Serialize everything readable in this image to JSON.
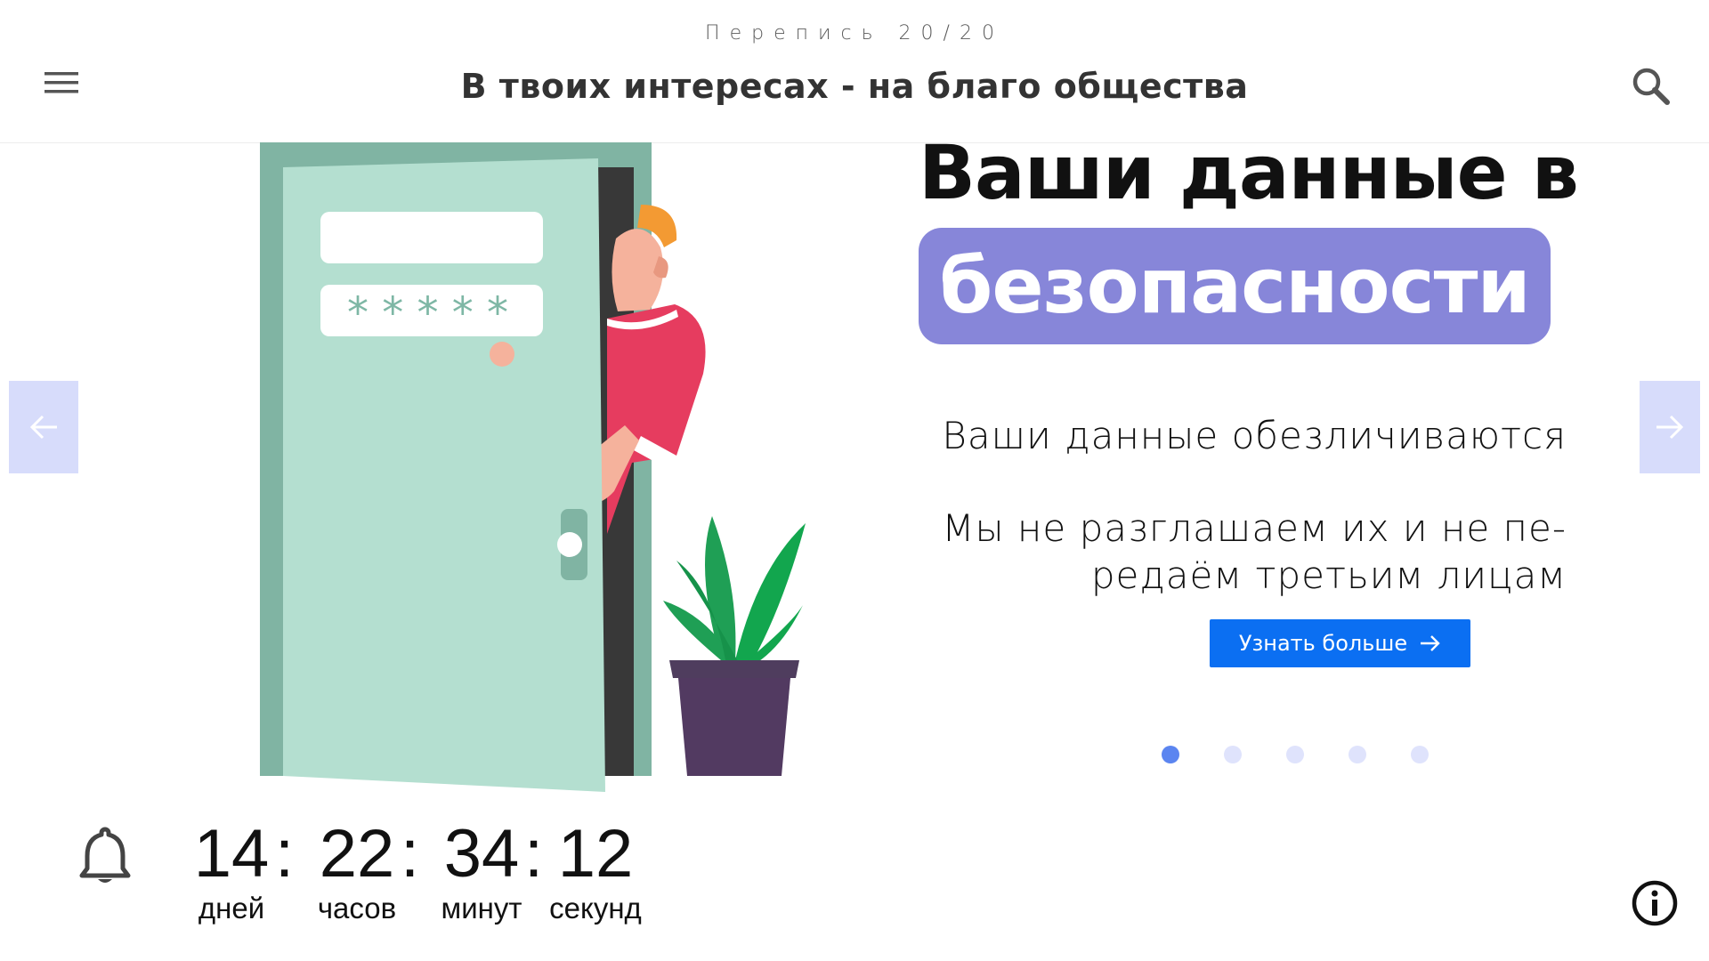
{
  "header": {
    "brand": "Перепись 20/20",
    "tagline": "В твоих интересах - на благо общества"
  },
  "slide": {
    "headline_line1": "Ваши данные в",
    "headline_highlight": "безопасности",
    "description_1": "Ваши данные обезличиваются",
    "description_2_line1": "Мы не разглашаем их и не пе-",
    "description_2_line2": "редаём третьим лицам",
    "cta_label": "Узнать больше",
    "illustration": {
      "password_mask": "* * * * *"
    }
  },
  "carousel": {
    "slide_count": 5,
    "active_index": 0
  },
  "countdown": {
    "days": "14",
    "hours": "22",
    "minutes": "34",
    "seconds": "12",
    "separator": ":",
    "days_label": "дней",
    "hours_label": "часов",
    "minutes_label": "минут",
    "seconds_label": "секунд"
  },
  "icons": {
    "menu": "hamburger-icon",
    "search": "magnifier-icon",
    "prev": "arrow-left-icon",
    "next": "arrow-right-icon",
    "cta": "arrow-right-icon",
    "bell": "bell-icon",
    "info": "info-icon"
  },
  "colors": {
    "accent": "#8786d9",
    "cta": "#0b6ff2",
    "nav_arrow_bg": "#d7dcfb",
    "dot_active": "#5b85f0",
    "dot_inactive": "#dfe3fc"
  }
}
